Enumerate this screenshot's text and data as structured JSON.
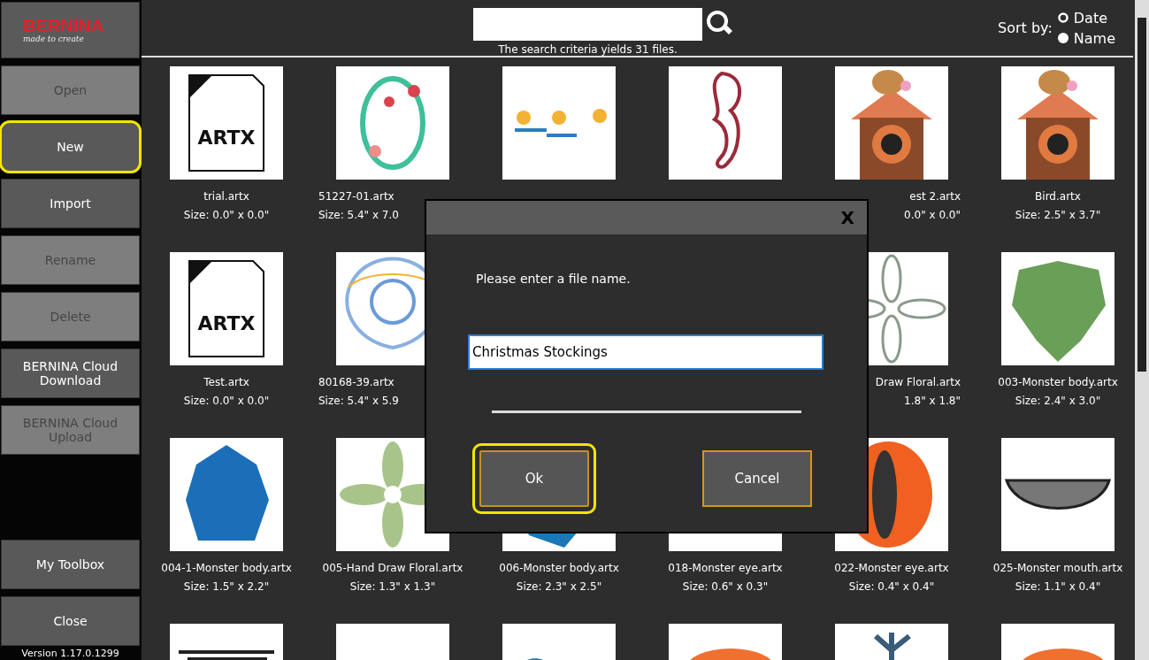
{
  "sidebar": {
    "logo": {
      "brand": "BERNINA",
      "tagline": "made to create"
    },
    "top_buttons": [
      {
        "label": "Open",
        "disabled": true,
        "selected": false
      },
      {
        "label": "New",
        "disabled": false,
        "selected": true
      },
      {
        "label": "Import",
        "disabled": false,
        "selected": false
      },
      {
        "label": "Rename",
        "disabled": true,
        "selected": false
      },
      {
        "label": "Delete",
        "disabled": true,
        "selected": false
      },
      {
        "label": "BERNINA Cloud Download",
        "disabled": false,
        "selected": false
      },
      {
        "label": "BERNINA Cloud Upload",
        "disabled": true,
        "selected": false
      }
    ],
    "bottom_buttons": [
      {
        "label": "My Toolbox",
        "disabled": false,
        "selected": false
      },
      {
        "label": "Close",
        "disabled": false,
        "selected": false
      }
    ],
    "version": "Version 1.17.0.1299"
  },
  "search": {
    "caption": "The search criteria yields 31 files."
  },
  "sort": {
    "label": "Sort by:",
    "options": [
      {
        "label": "Date",
        "selected": false
      },
      {
        "label": "Name",
        "selected": true
      }
    ]
  },
  "files": [
    {
      "kind": "artx",
      "badge": "ARTX",
      "name": "trial.artx",
      "size": "Size: 0.0\" x 0.0\""
    },
    {
      "kind": "wreath",
      "name": "51227-01.artx",
      "size": "Size: 5.4\" x 7.0"
    },
    {
      "kind": "letters"
    },
    {
      "kind": "seahorse"
    },
    {
      "kind": "birdhouse",
      "name": "est 2.artx",
      "size": "0.0\" x 0.0\""
    },
    {
      "kind": "birdhouse",
      "name": "Bird.artx",
      "size": "Size: 2.5\" x 3.7\""
    },
    {
      "kind": "artx",
      "badge": "ARTX",
      "name": "Test.artx",
      "size": "Size: 0.0\" x 0.0\""
    },
    {
      "kind": "lace",
      "name": "80168-39.artx",
      "size": "Size: 5.4\" x 5.9"
    },
    {
      "kind": "covered"
    },
    {
      "kind": "covered"
    },
    {
      "kind": "outline-flower",
      "name": "Draw Floral.artx",
      "size": "1.8\" x 1.8\""
    },
    {
      "kind": "leaf",
      "name": "003-Monster body.artx",
      "size": "Size: 2.4\" x 3.0\""
    },
    {
      "kind": "blue-blob",
      "name": "004-1-Monster body.artx",
      "size": "Size: 1.5\" x 2.2\""
    },
    {
      "kind": "green-flower",
      "name": "005-Hand Draw Floral.artx",
      "size": "Size: 1.3\" x 1.3\""
    },
    {
      "kind": "blue-shape",
      "name": "006-Monster body.artx",
      "size": "Size: 2.3\" x 2.5\""
    },
    {
      "kind": "blank",
      "name": "018-Monster eye.artx",
      "size": "Size: 0.6\" x 0.3\""
    },
    {
      "kind": "orange-eye",
      "name": "022-Monster eye.artx",
      "size": "Size: 0.4\" x 0.4\""
    },
    {
      "kind": "mouth",
      "name": "025-Monster mouth.artx",
      "size": "Size: 1.1\" x 0.4\""
    },
    {
      "kind": "dark-lines"
    },
    {
      "kind": "blank"
    },
    {
      "kind": "blue-shape"
    },
    {
      "kind": "orange-feather"
    },
    {
      "kind": "plant"
    },
    {
      "kind": "orange-feather"
    }
  ],
  "dialog": {
    "close": "X",
    "prompt": "Please enter a file name.",
    "value": "Christmas Stockings",
    "buttons": [
      {
        "label": "Ok",
        "focused": true
      },
      {
        "label": "Cancel",
        "focused": false
      }
    ]
  }
}
